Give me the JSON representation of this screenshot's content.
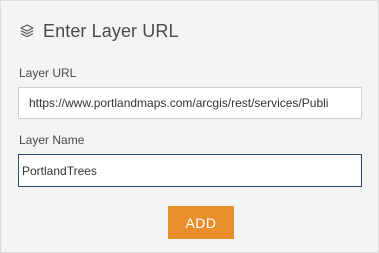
{
  "header": {
    "icon": "layers-icon",
    "title": "Enter Layer URL"
  },
  "form": {
    "url_label": "Layer URL",
    "url_value": "https://www.portlandmaps.com/arcgis/rest/services/Publi",
    "name_label": "Layer Name",
    "name_value": "PortlandTrees"
  },
  "actions": {
    "add_label": "ADD",
    "add_color": "#e88f2c"
  }
}
